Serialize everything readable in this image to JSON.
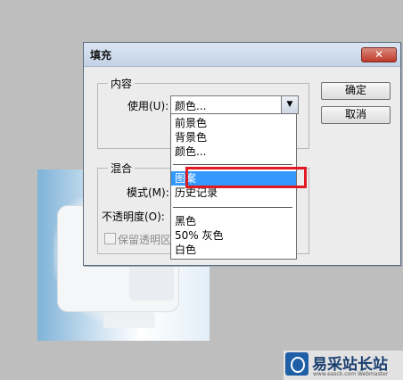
{
  "dialog": {
    "title": "填充",
    "close_label": "✕",
    "content_group": {
      "title": "内容",
      "use_label": "使用(U):",
      "use_value": "颜色..."
    },
    "blend_group": {
      "title": "混合",
      "mode_label": "模式(M):",
      "opacity_label": "不透明度(O):",
      "preserve_label": "保留透明区"
    },
    "buttons": {
      "ok": "确定",
      "cancel": "取消"
    }
  },
  "dropdown": {
    "items": [
      "前景色",
      "背景色",
      "颜色...",
      "图案",
      "历史记录",
      "黑色",
      "50% 灰色",
      "白色"
    ],
    "selected": "图案"
  },
  "watermark": {
    "brand": "易采站长站",
    "sub": "www.easck.com Webmaster"
  },
  "colors": {
    "highlight": "#e01a22",
    "selection": "#3399ff"
  }
}
